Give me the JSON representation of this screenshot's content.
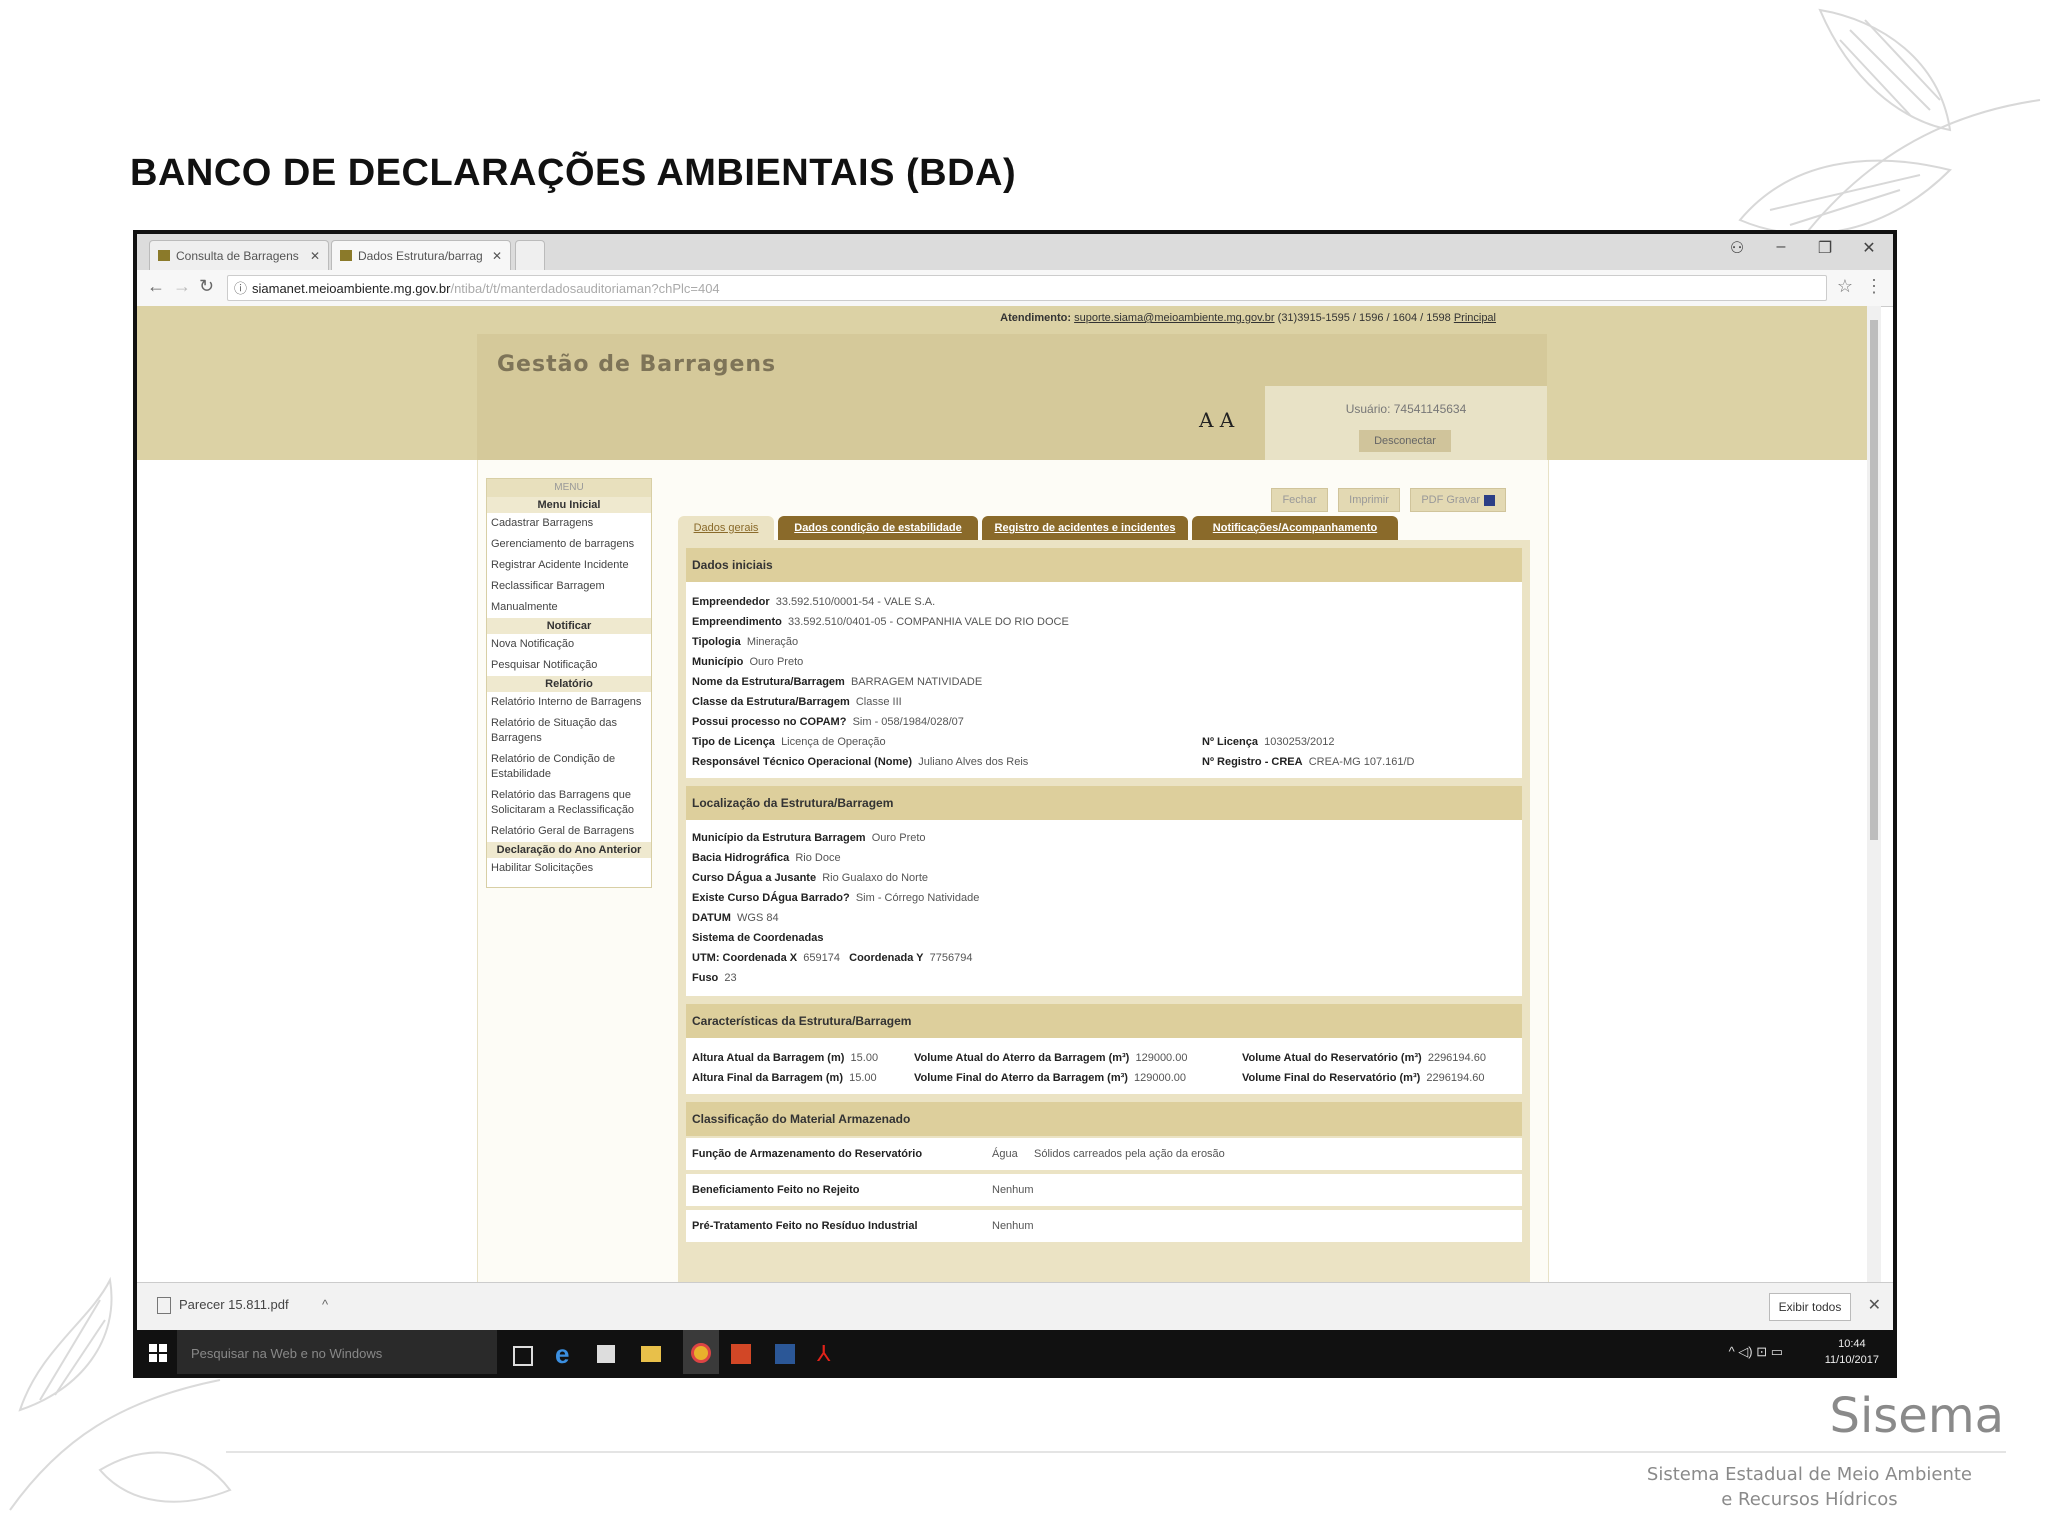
{
  "slide": {
    "title": "BANCO DE DECLARAÇÕES AMBIENTAIS (BDA)",
    "logo_name": "Sisema",
    "logo_subtitle_1": "Sistema Estadual de Meio Ambiente",
    "logo_subtitle_2": "e Recursos Hídricos"
  },
  "browser": {
    "tabs": [
      "Consulta de Barragens",
      "Dados Estrutura/barrag"
    ],
    "url_host": "siamanet.meioambiente.mg.gov.br",
    "url_path": "/ntiba/t/t/manterdadosauditoriaman?chPlc=404"
  },
  "page": {
    "contact_label": "Atendimento:",
    "contact_email": "suporte.siama@meioambiente.mg.gov.br",
    "contact_phones": "(31)3915-1595 / 1596 / 1604 / 1598",
    "contact_home": "Principal",
    "title": "Gestão de Barragens",
    "font_sizer": "A A",
    "user_label": "Usuário: 74541145634",
    "logout_label": "Desconectar",
    "actions": {
      "close": "Fechar",
      "print": "Imprimir",
      "save_pdf": "PDF Gravar"
    }
  },
  "menu": {
    "title": "MENU",
    "home": "Menu Inicial",
    "items_1": [
      "Cadastrar Barragens",
      "Gerenciamento de barragens",
      "Registrar Acidente Incidente",
      "Reclassificar Barragem",
      "Manualmente"
    ],
    "notify_head": "Notificar",
    "items_2": [
      "Nova Notificação",
      "Pesquisar Notificação"
    ],
    "reports_head": "Relatório",
    "items_3": [
      "Relatório Interno de Barragens",
      "Relatório de Situação das Barragens",
      "Relatório de Condição de Estabilidade",
      "Relatório das Barragens que Solicitaram a Reclassificação",
      "Relatório Geral de Barragens"
    ],
    "decl_head": "Declaração do Ano Anterior",
    "items_4": [
      "Habilitar Solicitações"
    ]
  },
  "page_tabs": [
    "Dados gerais",
    "Dados condição de estabilidade",
    "Registro de acidentes e incidentes",
    "Notificações/Acompanhamento"
  ],
  "sections": {
    "initial": {
      "head": "Dados iniciais",
      "rows": [
        {
          "label": "Empreendedor",
          "value": "33.592.510/0001-54 - VALE S.A."
        },
        {
          "label": "Empreendimento",
          "value": "33.592.510/0401-05 - COMPANHIA VALE DO RIO DOCE"
        },
        {
          "label": "Tipologia",
          "value": "Mineração"
        },
        {
          "label": "Município",
          "value": "Ouro Preto"
        },
        {
          "label": "Nome da Estrutura/Barragem",
          "value": "BARRAGEM NATIVIDADE"
        },
        {
          "label": "Classe da Estrutura/Barragem",
          "value": "Classe III"
        },
        {
          "label": "Possui processo no COPAM?",
          "value": "Sim - 058/1984/028/07"
        },
        {
          "label": "Tipo de Licença",
          "value": "Licença de Operação"
        },
        {
          "label": "Responsável Técnico Operacional (Nome)",
          "value": "Juliano Alves dos Reis"
        }
      ],
      "license_label": "Nº Licença",
      "license_value": "1030253/2012",
      "registry_label": "Nº Registro - CREA",
      "registry_value": "CREA-MG 107.161/D"
    },
    "location": {
      "head": "Localização da Estrutura/Barragem",
      "rows": [
        {
          "label": "Município da Estrutura Barragem",
          "value": "Ouro Preto"
        },
        {
          "label": "Bacia Hidrográfica",
          "value": "Rio Doce"
        },
        {
          "label": "Curso DÁgua a Jusante",
          "value": "Rio Gualaxo do Norte"
        },
        {
          "label": "Existe Curso DÁgua Barrado?",
          "value": "Sim - Córrego Natividade"
        },
        {
          "label": "DATUM",
          "value": "WGS 84"
        },
        {
          "label": "Sistema de Coordenadas",
          "value": ""
        },
        {
          "label": "UTM: Coordenada X",
          "value": "659174"
        },
        {
          "label": "Fuso",
          "value": "23"
        }
      ],
      "coord_y_label": "Coordenada Y",
      "coord_y_value": "7756794"
    },
    "characteristics": {
      "head": "Características da Estrutura/Barragem",
      "rows": [
        {
          "a_label": "Altura Atual da Barragem (m)",
          "a_value": "15.00",
          "b_label": "Volume Atual do Aterro da Barragem (m³)",
          "b_value": "129000.00",
          "c_label": "Volume Atual do Reservatório (m³)",
          "c_value": "2296194.60"
        },
        {
          "a_label": "Altura Final da Barragem (m)",
          "a_value": "15.00",
          "b_label": "Volume Final do Aterro da Barragem (m³)",
          "b_value": "129000.00",
          "c_label": "Volume Final do Reservatório (m³)",
          "c_value": "2296194.60"
        }
      ]
    },
    "material": {
      "head": "Classificação do Material Armazenado",
      "rows": [
        {
          "label": "Função de Armazenamento do Reservatório",
          "value": "Água",
          "extra": "Sólidos carreados pela ação da erosão"
        },
        {
          "label": "Beneficiamento Feito no Rejeito",
          "value": "Nenhum",
          "extra": ""
        },
        {
          "label": "Pré-Tratamento Feito no Resíduo Industrial",
          "value": "Nenhum",
          "extra": ""
        }
      ]
    }
  },
  "download": {
    "file": "Parecer 15.811.pdf",
    "show_all": "Exibir todos"
  },
  "taskbar": {
    "search": "Pesquisar na Web e no Windows",
    "time": "10:44",
    "date": "11/10/2017"
  }
}
